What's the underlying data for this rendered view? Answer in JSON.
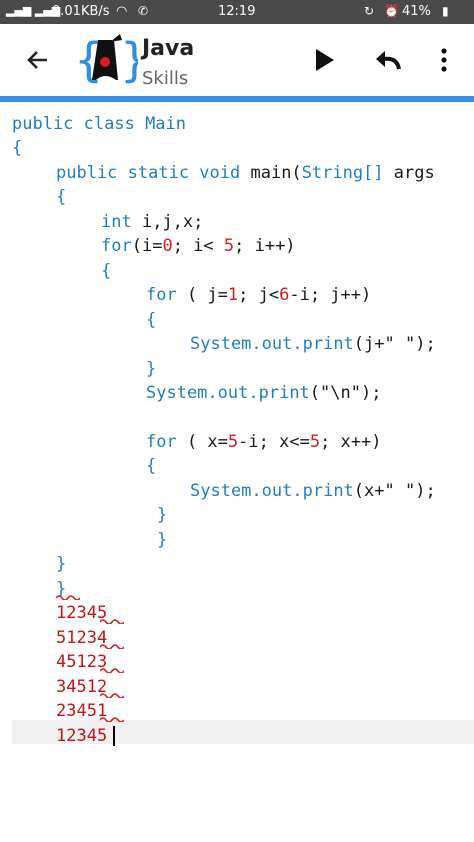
{
  "status": {
    "network": "0.01KB/s",
    "time": "12:19",
    "battery": "41%"
  },
  "appbar": {
    "title": "Java",
    "subtitle": "Skills",
    "back_icon": "arrow-left-icon",
    "run_icon": "play-icon",
    "undo_icon": "undo-icon",
    "menu_icon": "more-vertical-icon"
  },
  "code": {
    "l1": {
      "a": "public class ",
      "b": "Main"
    },
    "l2": "{",
    "l3": {
      "a": "public static ",
      "b": "void ",
      "c": "main(",
      "d": "String[] ",
      "e": "args"
    },
    "l4": "{",
    "l5": {
      "a": "int ",
      "b": "i,j,x;"
    },
    "l6": {
      "a": "for",
      "b": "(i=",
      "c": "0",
      "d": "; i< ",
      "e": "5",
      "f": "; i++)"
    },
    "l7": "{",
    "l8": {
      "a": "for ",
      "b": "( j=",
      "c": "1",
      "d": "; j<",
      "e": "6",
      "f": "-i; j++)"
    },
    "l9": "{",
    "l10": {
      "a": "System.",
      "b": "out.",
      "c": "print",
      "d": "(j+\" \");"
    },
    "l11": "}",
    "l12": {
      "a": "System.",
      "b": "out.",
      "c": "print",
      "d": "(\"\\n\");"
    },
    "l13": {
      "a": "for ",
      "b": "( x=",
      "c": "5",
      "d": "-i; x<=",
      "e": "5",
      "f": "; x++)"
    },
    "l14": "{",
    "l15": {
      "a": "System.",
      "b": "out.",
      "c": "print",
      "d": "(x+\" \");"
    },
    "l16": "}",
    "l17": "}",
    "l18": "}",
    "l19": "}"
  },
  "output": [
    "12345",
    "51234",
    "45123",
    "34512",
    "23451",
    "12345"
  ]
}
